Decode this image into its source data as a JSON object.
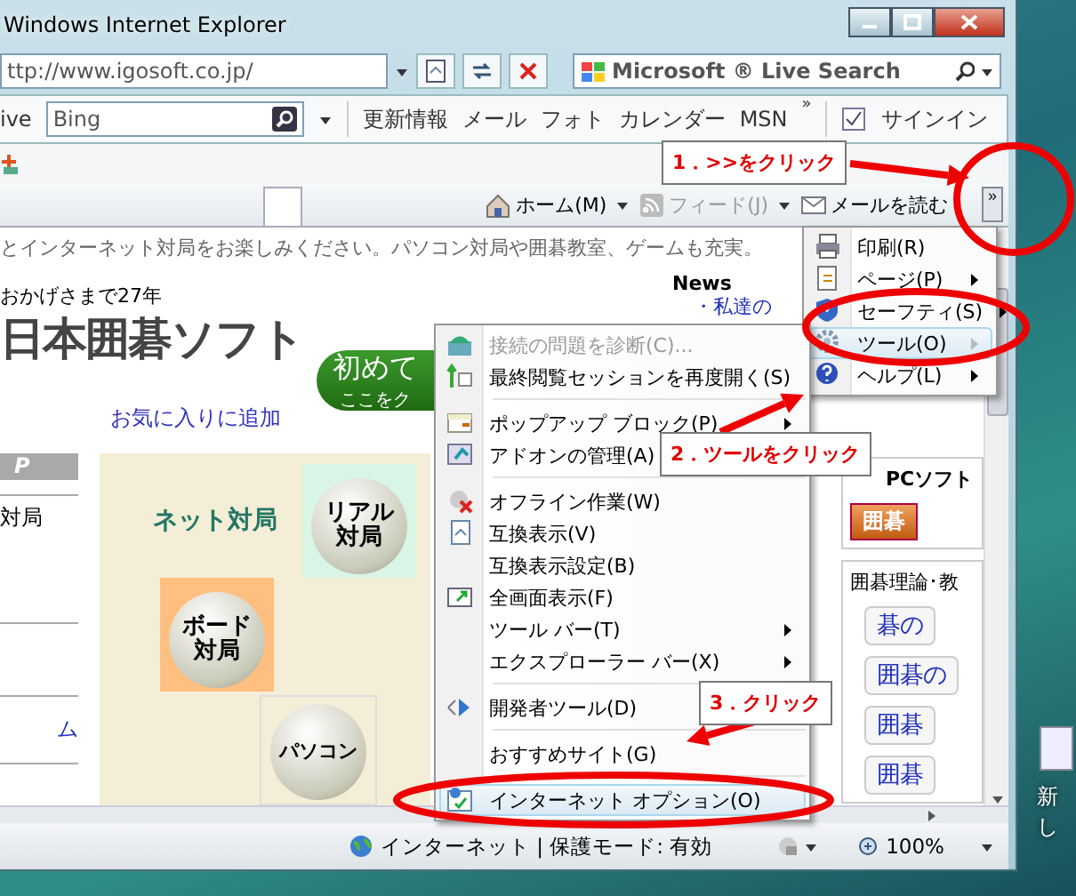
{
  "window": {
    "title": "Windows Internet Explorer"
  },
  "address_bar": {
    "url": "ttp://www.igosoft.co.jp/"
  },
  "search_box": {
    "value": "Microsoft ® Live Search"
  },
  "links_bar": {
    "label": "ive",
    "search_value": "Bing",
    "links": [
      "更新情報",
      "メール",
      "フォト",
      "カレンダー",
      "MSN"
    ],
    "more": "»",
    "sign_in": "サインイン"
  },
  "command_bar": {
    "items": [
      {
        "label": "ホーム(M)",
        "disabled": false
      },
      {
        "label": "フィード(J)",
        "disabled": true
      },
      {
        "label": "メールを読む",
        "disabled": false
      }
    ],
    "more": "»"
  },
  "page": {
    "intro": "とインターネット対局をお楽しみください。パソコン対局や囲碁教室、ゲームも充実。",
    "tagline": "おかげさまで27年",
    "logo": "日本囲碁ソフト",
    "favorite_link": "お気に入りに追加",
    "start_button": {
      "title": "初めて",
      "subtitle": "ここをク"
    },
    "news": {
      "title": "News",
      "link": "・私達の"
    },
    "sidebar": {
      "header": "P",
      "item": "対局",
      "link": "ム"
    },
    "net_label": "ネット対局",
    "circles": [
      {
        "lines": [
          "リアル",
          "対局"
        ]
      },
      {
        "lines": [
          "ボード",
          "対局"
        ]
      },
      {
        "lines": [
          "パソコン"
        ]
      }
    ],
    "right": {
      "pc_soft": "PCソフト",
      "igo_button": "囲碁",
      "theory": "囲碁理論･教",
      "buttons": [
        "碁の",
        "囲碁の",
        "囲碁",
        "囲碁"
      ]
    }
  },
  "command_menu": {
    "items": [
      {
        "kind": "item",
        "label": "印刷(R)",
        "selected": false
      },
      {
        "kind": "submenu",
        "label": "ページ(P)",
        "selected": false
      },
      {
        "kind": "submenu",
        "label": "セーフティ(S)",
        "selected": false
      },
      {
        "kind": "submenu",
        "label": "ツール(O)",
        "selected": true
      },
      {
        "kind": "submenu",
        "label": "ヘルプ(L)",
        "selected": false
      }
    ]
  },
  "tools_menu": {
    "items": [
      {
        "kind": "item",
        "label": "接続の問題を診断(C)...",
        "disabled": true,
        "selected": false
      },
      {
        "kind": "item",
        "label": "最終閲覧セッションを再度開く(S)",
        "disabled": false,
        "selected": false
      },
      {
        "kind": "separator"
      },
      {
        "kind": "submenu",
        "label": "ポップアップ ブロック(P)",
        "disabled": false,
        "selected": false
      },
      {
        "kind": "item",
        "label": "アドオンの管理(A)",
        "disabled": false,
        "selected": false
      },
      {
        "kind": "separator"
      },
      {
        "kind": "item",
        "label": "オフライン作業(W)",
        "disabled": false,
        "selected": false
      },
      {
        "kind": "item",
        "label": "互換表示(V)",
        "disabled": false,
        "selected": false
      },
      {
        "kind": "item",
        "label": "互換表示設定(B)",
        "disabled": false,
        "selected": false
      },
      {
        "kind": "item",
        "label": "全画面表示(F)",
        "disabled": false,
        "selected": false
      },
      {
        "kind": "submenu",
        "label": "ツール バー(T)",
        "disabled": false,
        "selected": false
      },
      {
        "kind": "submenu",
        "label": "エクスプローラー バー(X)",
        "disabled": false,
        "selected": false
      },
      {
        "kind": "separator"
      },
      {
        "kind": "item",
        "label": "開発者ツール(D)",
        "disabled": false,
        "selected": false
      },
      {
        "kind": "separator"
      },
      {
        "kind": "item",
        "label": "おすすめサイト(G)",
        "disabled": false,
        "selected": false
      },
      {
        "kind": "separator"
      },
      {
        "kind": "item",
        "label": "インターネット オプション(O)",
        "disabled": false,
        "selected": true
      }
    ]
  },
  "status_bar": {
    "zone": "インターネット | 保護モード: 有効",
    "zoom": "100%"
  },
  "desktop": {
    "icon_label": "新し"
  },
  "annotations": [
    {
      "text": "1．>>をクリック"
    },
    {
      "text": "2．ツールをクリック"
    },
    {
      "text": "3．クリック"
    }
  ]
}
